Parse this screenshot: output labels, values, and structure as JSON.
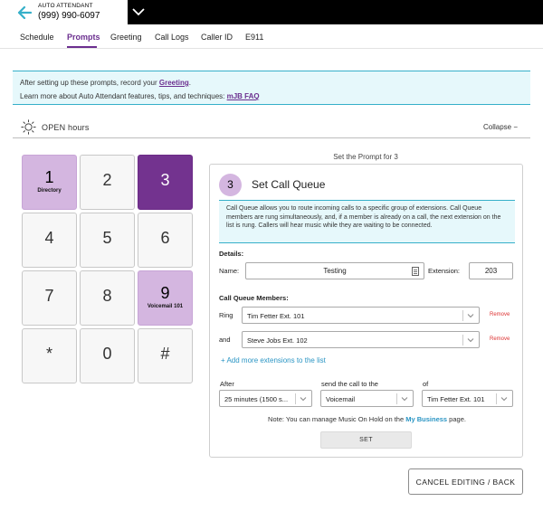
{
  "header": {
    "subtitle": "AUTO ATTENDANT",
    "phone": "(999) 990-6097"
  },
  "tabs": [
    "Schedule",
    "Prompts",
    "Greeting",
    "Call Logs",
    "Caller ID",
    "E911"
  ],
  "active_tab": "Prompts",
  "banner": {
    "line1_prefix": "After setting up these prompts, record your ",
    "line1_link": "Greeting",
    "line1_suffix": ".",
    "line2_prefix": "Learn more about Auto Attendant features, tips, and techniques: ",
    "line2_link": "mJB FAQ"
  },
  "hours": {
    "title": "OPEN hours",
    "collapse": "Collapse −"
  },
  "keypad": [
    {
      "digit": "1",
      "label": "Directory",
      "state": "configured"
    },
    {
      "digit": "2",
      "label": "",
      "state": "empty"
    },
    {
      "digit": "3",
      "label": "",
      "state": "selected"
    },
    {
      "digit": "4",
      "label": "",
      "state": "empty"
    },
    {
      "digit": "5",
      "label": "",
      "state": "empty"
    },
    {
      "digit": "6",
      "label": "",
      "state": "empty"
    },
    {
      "digit": "7",
      "label": "",
      "state": "empty"
    },
    {
      "digit": "8",
      "label": "",
      "state": "empty"
    },
    {
      "digit": "9",
      "label": "Voicemail 101",
      "state": "configured"
    },
    {
      "digit": "*",
      "label": "",
      "state": "empty"
    },
    {
      "digit": "0",
      "label": "",
      "state": "empty"
    },
    {
      "digit": "#",
      "label": "",
      "state": "empty"
    }
  ],
  "panel": {
    "prompt_for": "Set the Prompt for 3",
    "step": "3",
    "title": "Set Call Queue",
    "description": "Call Queue allows you to route incoming calls to a specific group of extensions. Call Queue members are rung simultaneously, and, if a member is already on a call, the next extension on the list is rung. Callers will hear music while they are waiting to be connected.",
    "details_label": "Details:",
    "name_label": "Name:",
    "name_value": "Testing",
    "extension_label": "Extension:",
    "extension_value": "203",
    "members_label": "Call Queue Members:",
    "ring_label": "Ring",
    "ring_value": "Tim Fetter Ext. 101",
    "and_label": "and",
    "and_value": "Steve Jobs Ext. 102",
    "remove_label": "Remove",
    "add_more": "+ Add more extensions to the list",
    "after_label": "After",
    "after_value": "25 minutes (1500 s...",
    "send_label": "send the call to the",
    "send_value": "Voicemail",
    "of_label": "of",
    "of_value": "Tim Fetter Ext. 101",
    "note_prefix": "Note: You can manage Music On Hold on the ",
    "note_link": "My Business",
    "note_suffix": " page.",
    "set_button": "SET"
  },
  "cancel_button": "CANCEL EDITING / BACK",
  "colors": {
    "accent_purple": "#6b2e8f",
    "key_dark": "#73338f",
    "key_light": "#d4b6e0",
    "info_bg": "#e6f8fb",
    "info_border": "#36b0c9",
    "link_blue": "#2a95c4",
    "remove_red": "#d33333"
  }
}
